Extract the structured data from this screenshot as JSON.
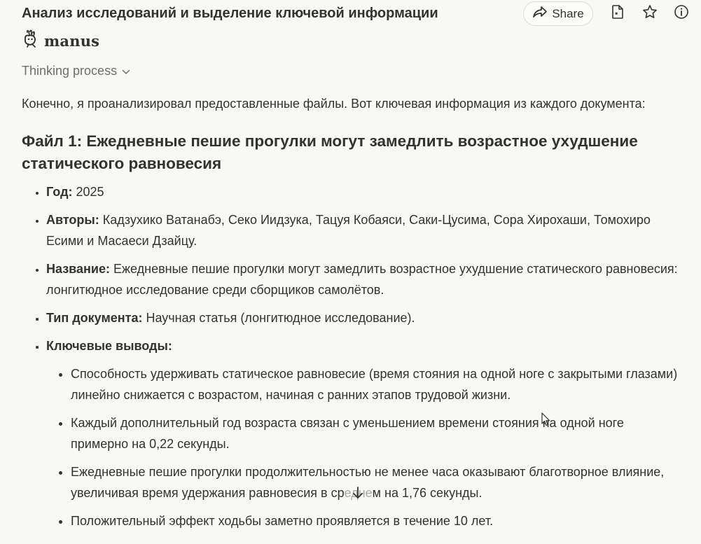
{
  "header": {
    "title": "Анализ исследований и выделение ключевой информации",
    "share_label": "Share"
  },
  "brand": {
    "name": "manus"
  },
  "thinking": {
    "label": "Thinking process"
  },
  "message": {
    "intro": "Конечно, я проанализировал предоставленные файлы. Вот ключевая информация из каждого документа:",
    "file1": {
      "heading": "Файл 1: Ежедневные пешие прогулки могут замедлить возрастное ухудшение статического равновесия",
      "year_label": "Год:",
      "year_value": "2025",
      "authors_label": "Авторы:",
      "authors_value": "Кадзухико Ватанабэ, Секо Иидзука, Тацуя Кобаяси, Саки-Цусима, Сора Хирохаши, Томохиро Есими и Масаеси Дзайцу.",
      "title_label": "Название:",
      "title_value": "Ежедневные пешие прогулки могут замедлить возрастное ухудшение статического равновесия: лонгитюдное исследование среди сборщиков самолётов.",
      "doctype_label": "Тип документа:",
      "doctype_value": "Научная статья (лонгитюдное исследование).",
      "findings_label": "Ключевые выводы:",
      "findings": [
        "Способность удерживать статическое равновесие (время стояния на одной ноге с закрытыми глазами) линейно снижается с возрастом, начиная с ранних этапов трудовой жизни.",
        "Каждый дополнительный год возраста связан с уменьшением времени стояния на одной ноге примерно на 0,22 секунды.",
        "Ежедневные пешие прогулки продолжительностью не менее часа оказывают благотворное влияние, увеличивая время удержания равновесия в среднем на 1,76 секунды.",
        "Положительный эффект ходьбы заметно проявляется в течение 10 лет."
      ]
    }
  }
}
